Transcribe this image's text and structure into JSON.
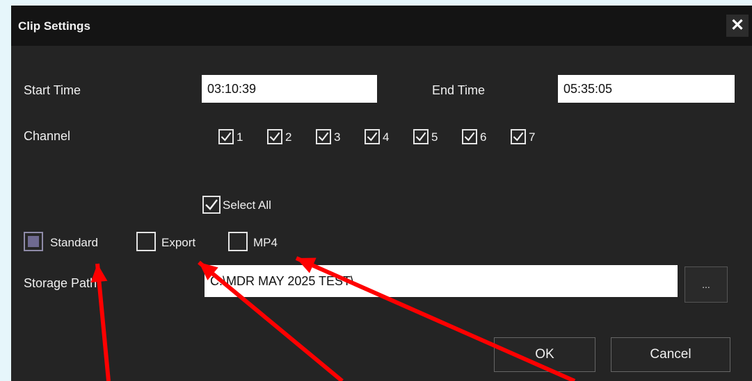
{
  "dialog": {
    "title": "Clip Settings",
    "close_glyph": "✕"
  },
  "time": {
    "start_label": "Start Time",
    "start_value": "03:10:39",
    "end_label": "End Time",
    "end_value": "05:35:05"
  },
  "channel": {
    "label": "Channel",
    "items": [
      {
        "label": "1",
        "checked": true
      },
      {
        "label": "2",
        "checked": true
      },
      {
        "label": "3",
        "checked": true
      },
      {
        "label": "4",
        "checked": true
      },
      {
        "label": "5",
        "checked": true
      },
      {
        "label": "6",
        "checked": true
      },
      {
        "label": "7",
        "checked": true
      }
    ],
    "select_all_label": "Select All",
    "select_all_checked": true
  },
  "format": {
    "standard_label": "Standard",
    "standard_checked": true,
    "export_label": "Export",
    "export_checked": false,
    "mp4_label": "MP4",
    "mp4_checked": false
  },
  "storage": {
    "label": "Storage Path",
    "value": "C:\\MDR MAY 2025 TEST\\",
    "browse_label": "..."
  },
  "buttons": {
    "ok_label": "OK",
    "cancel_label": "Cancel"
  },
  "annotation": {
    "arrow_color": "#ff0000"
  }
}
